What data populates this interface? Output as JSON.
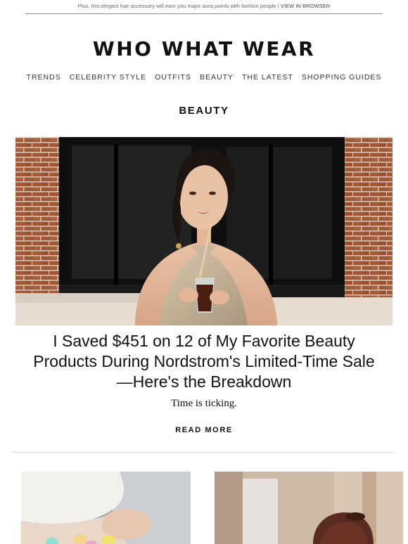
{
  "preheader": {
    "text": "Plus, this elegant hair accessory will earn you major aura points with fashion people | ",
    "link": "VIEW IN BROWSER"
  },
  "logo": "WHO WHAT WEAR",
  "nav": [
    "TRENDS",
    "CELEBRITY STYLE",
    "OUTFITS",
    "BEAUTY",
    "THE LATEST",
    "SHOPPING GUIDES"
  ],
  "section": "BEAUTY",
  "article": {
    "headline": "I Saved $451 on 12 of My Favorite Beauty Products During Nordstrom's Limited-Time Sale—Here's the Breakdown",
    "dek": "Time is ticking.",
    "cta": "READ MORE"
  }
}
